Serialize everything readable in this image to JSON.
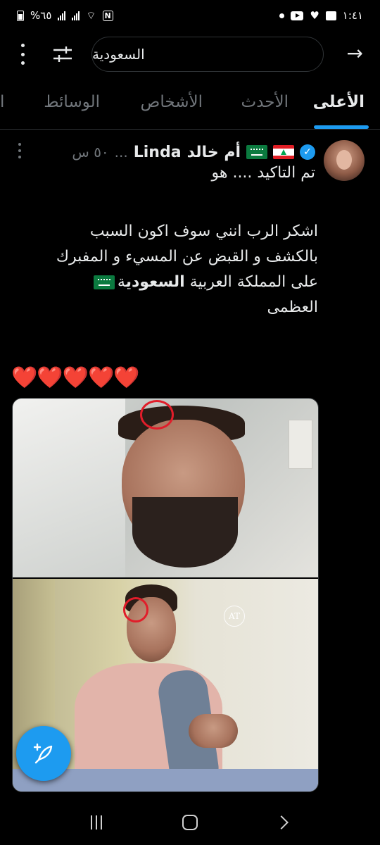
{
  "status_bar": {
    "time": "١:٤١",
    "battery": "%٦٥"
  },
  "search": {
    "query": "السعودية"
  },
  "tabs": [
    {
      "label": "الأعلى",
      "active": true
    },
    {
      "label": "الأحدث",
      "active": false
    },
    {
      "label": "الأشخاص",
      "active": false
    },
    {
      "label": "الوسائط",
      "active": false
    },
    {
      "label": "ا",
      "active": false
    }
  ],
  "post": {
    "display_name": "أم خالد",
    "name_latin": "Linda",
    "truncation": "...",
    "time": "٥٠ س",
    "subline": "تم التاكيد .... هو",
    "body_line1": "اشكر الرب انني سوف اكون السبب",
    "body_line2": "بالكشف و القبض عن المسيء و المفبرك",
    "body_line3_pre": "على المملكة العربية",
    "body_line3_highlight": "السعودي",
    "body_line3_post": "ة",
    "body_line4": "العظمى",
    "hearts": "❤️❤️❤️❤️❤️",
    "watermark": "AT"
  },
  "colors": {
    "accent": "#1d9bf0",
    "background": "#000000",
    "text_primary": "#e7e9ea",
    "text_secondary": "#71767b",
    "mark_red": "#e11d2a"
  },
  "icons": {
    "back": "arrow-right-icon",
    "filter": "sliders-icon",
    "more": "more-vertical-icon",
    "compose": "compose-feather-icon",
    "verified": "verified-badge-icon"
  }
}
